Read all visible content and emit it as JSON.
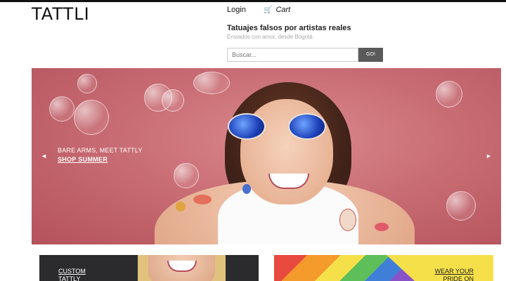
{
  "header": {
    "logo": "TATTLI",
    "login_label": "Login",
    "cart_icon": "cart-icon",
    "cart_label": "Cart",
    "tagline": "Tatuajes falsos por artistas reales",
    "subtagline": "Enviados con amor, desde Bogotá"
  },
  "search": {
    "placeholder": "Buscar...",
    "button_label": "GO!"
  },
  "hero": {
    "headline": "BARE ARMS, MEET TATTLY",
    "cta": "SHOP SUMMER",
    "prev_arrow": "◄",
    "next_arrow": "►"
  },
  "tiles": [
    {
      "line1": "CUSTOM",
      "line2": "TATTLY"
    },
    {
      "line1": "WEAR YOUR",
      "line2": "PRIDE ON"
    }
  ],
  "colors": {
    "hero_bg": "#c96d74",
    "go_button": "#5a5a5a",
    "tile_left_bg": "#2b2b2d",
    "tile_right_bg": "#f6e04a"
  }
}
